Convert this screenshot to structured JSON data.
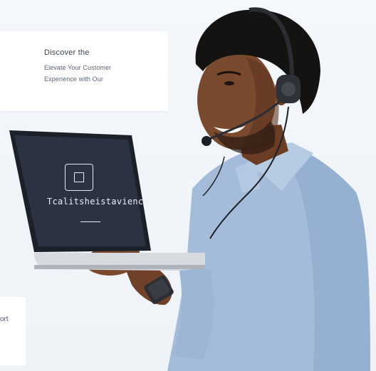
{
  "hero_card": {
    "title": "Discover the",
    "line1": "Elevate Your Customer",
    "line2": "Experience with Our"
  },
  "bottom_card": {
    "fragment": "ort"
  },
  "laptop_screen": {
    "text": "Tcalitsheistavience",
    "icon": "checkbox-square-icon"
  },
  "colors": {
    "background": "#f3f6fa",
    "shirt": "#9fb8d6",
    "skin": "#7a4a2e",
    "laptop_screen": "#2a3140"
  }
}
